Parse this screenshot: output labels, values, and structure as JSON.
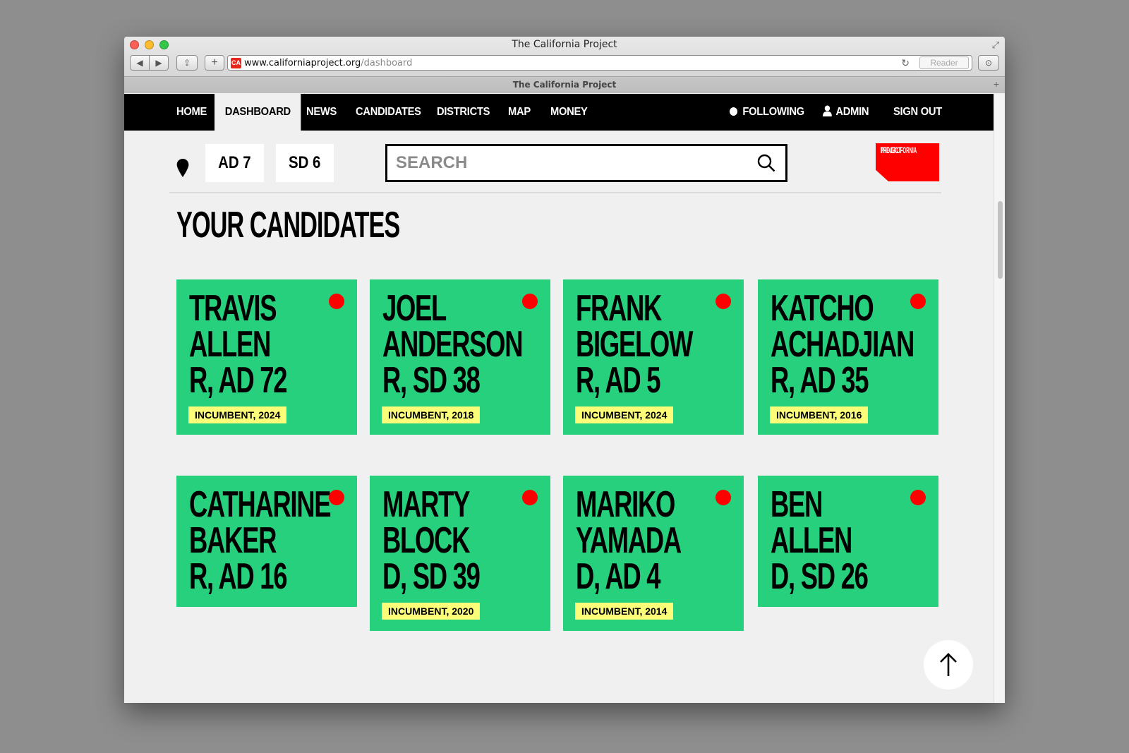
{
  "window": {
    "title": "The California Project",
    "url_host": "www.californiaproject.org",
    "url_path": "/dashboard",
    "reader_label": "Reader",
    "favicon_text": "CA",
    "tab_title": "The California Project"
  },
  "nav": {
    "items": [
      "HOME",
      "DASHBOARD",
      "NEWS",
      "CANDIDATES",
      "DISTRICTS",
      "MAP",
      "MONEY"
    ],
    "active": "DASHBOARD",
    "following": "FOLLOWING",
    "admin": "ADMIN",
    "signout": "SIGN OUT"
  },
  "location": {
    "assembly": "AD 7",
    "senate": "SD 6"
  },
  "search": {
    "placeholder": "SEARCH"
  },
  "logo": {
    "line1": "THE CALIFORNIA",
    "line2": "PROJECT"
  },
  "heading": "YOUR CANDIDATES",
  "candidates": [
    {
      "first": "TRAVIS",
      "last": "ALLEN",
      "district": "R, AD 72",
      "badge": "INCUMBENT, 2024"
    },
    {
      "first": "JOEL",
      "last": "ANDERSON",
      "district": "R, SD 38",
      "badge": "INCUMBENT, 2018"
    },
    {
      "first": "FRANK",
      "last": "BIGELOW",
      "district": "R, AD 5",
      "badge": "INCUMBENT, 2024"
    },
    {
      "first": "KATCHO",
      "last": "ACHADJIAN",
      "district": "R, AD 35",
      "badge": "INCUMBENT, 2016"
    },
    {
      "first": "CATHARINE",
      "last": "BAKER",
      "district": "R, AD 16",
      "badge": ""
    },
    {
      "first": "MARTY",
      "last": "BLOCK",
      "district": "D, SD 39",
      "badge": "INCUMBENT, 2020"
    },
    {
      "first": "MARIKO",
      "last": "YAMADA",
      "district": "D, AD 4",
      "badge": "INCUMBENT, 2014"
    },
    {
      "first": "BEN",
      "last": "ALLEN",
      "district": "D, SD 26",
      "badge": ""
    }
  ],
  "colors": {
    "card": "#26d07c",
    "dot": "#ff0000",
    "badge": "#fbfd78",
    "nav": "#000000",
    "logo": "#ff0000"
  },
  "icons": {
    "pin": "location-pin-icon",
    "search": "search-icon",
    "up": "arrow-up-icon",
    "following": "dot-icon",
    "admin": "user-icon"
  }
}
